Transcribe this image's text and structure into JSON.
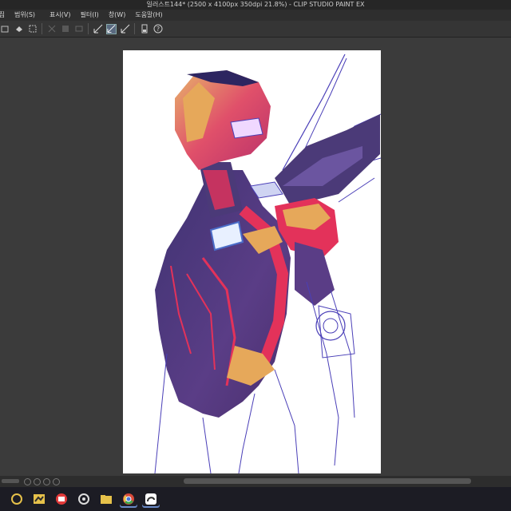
{
  "window": {
    "title": "일러스트144* (2500 x 4100px 350dpi 21.8%)  - CLIP STUDIO PAINT EX"
  },
  "menu": {
    "items": [
      {
        "label": "편집"
      },
      {
        "label": "범위(S)"
      },
      {
        "label": "표시(V)"
      },
      {
        "label": "필터(I)"
      },
      {
        "label": "창(W)"
      },
      {
        "label": "도움말(H)"
      }
    ]
  },
  "toolbar": {
    "icons": [
      "layer-icon",
      "fill-icon",
      "transform-icon",
      "clear-icon",
      "fill-selection-icon",
      "deselect-icon",
      "ruler-snap-icon",
      "special-ruler-icon",
      "grid-snap-icon",
      "layer-property-icon",
      "help-icon"
    ],
    "active_index": 7
  },
  "taskbar": {
    "apps": [
      "cortex-icon",
      "clip-studio-icon",
      "video-app-icon",
      "creative-cloud-icon",
      "file-explorer-icon",
      "chrome-icon",
      "clip-studio-paint-icon"
    ]
  },
  "colors": {
    "background": "#3b3b3b",
    "paper": "#ffffff",
    "lineart": "#4a3fb8",
    "armor_red": "#e3325a",
    "armor_gold": "#e6a85a",
    "armor_shadow": "#4b3a78"
  }
}
